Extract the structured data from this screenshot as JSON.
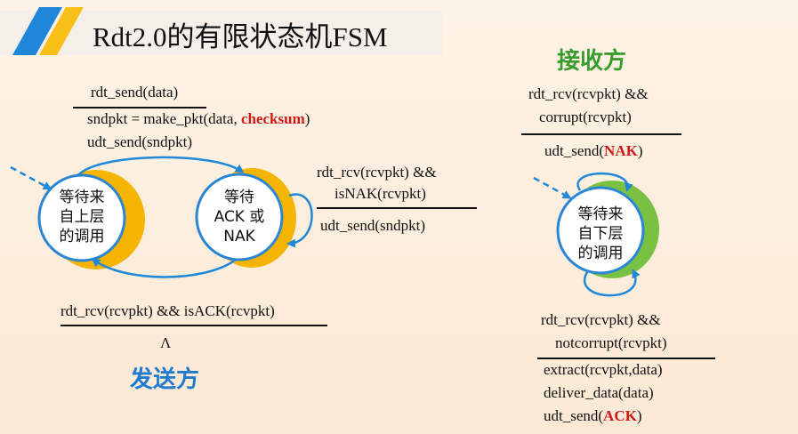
{
  "title": "Rdt2.0的有限状态机FSM",
  "sender": {
    "name": "发送方",
    "state1": {
      "line1": "等待来",
      "line2": "自上层",
      "line3": "的调用"
    },
    "state2": {
      "line1": "等待",
      "line2": "ACK 或",
      "line3": "NAK"
    },
    "t1": {
      "event": "rdt_send(data)",
      "action1_pre": "sndpkt = make_pkt(data, ",
      "action1_red": "checksum",
      "action1_post": ")",
      "action2": "udt_send(sndpkt)"
    },
    "t2": {
      "event1": "rdt_rcv(rcvpkt) &&",
      "event2": "isNAK(rcvpkt)",
      "action": "udt_send(sndpkt)"
    },
    "t3": {
      "event": "rdt_rcv(rcvpkt) && isACK(rcvpkt)",
      "action": "Λ"
    }
  },
  "receiver": {
    "name": "接收方",
    "state": {
      "line1": "等待来",
      "line2": "自下层",
      "line3": "的调用"
    },
    "t1": {
      "event1": "rdt_rcv(rcvpkt) &&",
      "event2": "corrupt(rcvpkt)",
      "action_pre": "udt_send(",
      "action_red": "NAK",
      "action_post": ")"
    },
    "t2": {
      "event1": "rdt_rcv(rcvpkt) &&",
      "event2": "notcorrupt(rcvpkt)",
      "action1": "extract(rcvpkt,data)",
      "action2": "deliver_data(data)",
      "action3_pre": "udt_send(",
      "action3_red": "ACK",
      "action3_post": ")"
    }
  },
  "colors": {
    "sender_accent": "#f4b400",
    "receiver_accent": "#7ac143",
    "arrow": "#1f88d8",
    "circle_border": "#2a86d4",
    "red": "#d31818"
  }
}
